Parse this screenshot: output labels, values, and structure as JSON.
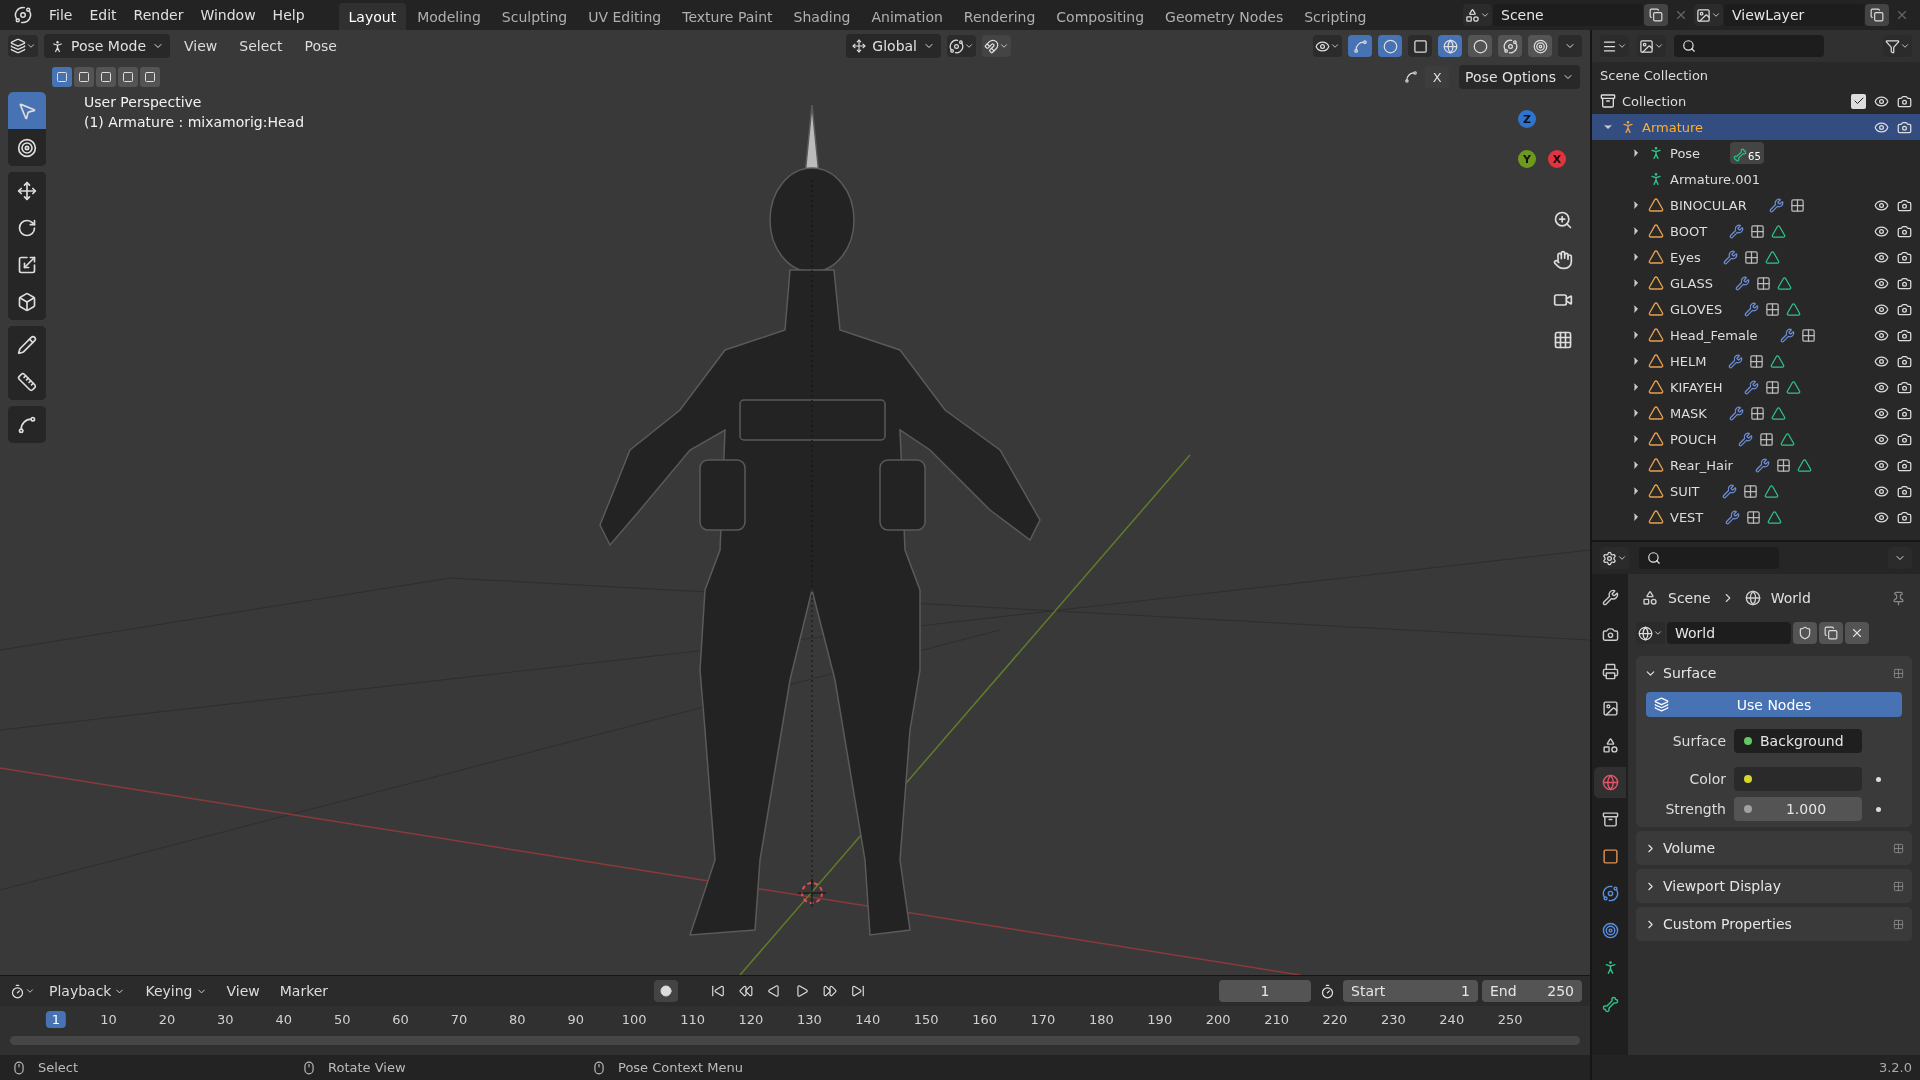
{
  "menu": [
    "File",
    "Edit",
    "Render",
    "Window",
    "Help"
  ],
  "workspaces": [
    {
      "label": "Layout",
      "selected": true
    },
    {
      "label": "Modeling",
      "selected": false
    },
    {
      "label": "Sculpting",
      "selected": false
    },
    {
      "label": "UV Editing",
      "selected": false
    },
    {
      "label": "Texture Paint",
      "selected": false
    },
    {
      "label": "Shading",
      "selected": false
    },
    {
      "label": "Animation",
      "selected": false
    },
    {
      "label": "Rendering",
      "selected": false
    },
    {
      "label": "Compositing",
      "selected": false
    },
    {
      "label": "Geometry Nodes",
      "selected": false
    },
    {
      "label": "Scripting",
      "selected": false
    }
  ],
  "scene": "Scene",
  "view_layer": "ViewLayer",
  "viewport": {
    "mode": "Pose Mode",
    "menus": [
      "View",
      "Select",
      "Pose"
    ],
    "orientation": "Global",
    "pose_options": "Pose Options",
    "mirror_x": "X",
    "select_modes": [
      {
        "selected": true
      },
      {
        "selected": false
      },
      {
        "selected": false
      },
      {
        "selected": false
      },
      {
        "selected": false
      }
    ],
    "shading": [
      {
        "kind": "wireframe",
        "selected": true
      },
      {
        "kind": "solid",
        "selected": false
      },
      {
        "kind": "material",
        "selected": false
      },
      {
        "kind": "rendered",
        "selected": false
      }
    ],
    "tools": [
      {
        "kind": "select",
        "selected": true
      },
      {
        "kind": "cursor",
        "selected": false
      },
      {
        "kind": "move",
        "selected": false
      },
      {
        "kind": "rotate",
        "selected": false
      },
      {
        "kind": "scale",
        "selected": false
      },
      {
        "kind": "transform",
        "selected": false
      },
      {
        "kind": "annotate",
        "selected": false
      },
      {
        "kind": "measure",
        "selected": false
      },
      {
        "kind": "relax",
        "selected": false
      }
    ],
    "overlay": [
      "User Perspective",
      "(1) Armature : mixamorig:Head"
    ],
    "gizmo": [
      {
        "label": "Z",
        "color": "#2f74d0"
      },
      {
        "label": "Y",
        "color": "#6e9a1c"
      },
      {
        "label": "X",
        "color": "#e2333f"
      }
    ]
  },
  "outliner": {
    "title": "Scene Collection",
    "collection": {
      "name": "Collection",
      "checked": true
    },
    "items": [
      {
        "name": "Armature",
        "kind": "armature",
        "selected": true,
        "expanded": true,
        "children": [
          {
            "name": "Pose",
            "kind": "pose",
            "expanded": false,
            "badge": "65"
          },
          {
            "name": "Armature.001",
            "kind": "armature_data"
          },
          {
            "name": "BINOCULAR",
            "kind": "mesh",
            "expanded": false,
            "has_mesh_data": false
          },
          {
            "name": "BOOT",
            "kind": "mesh",
            "expanded": false,
            "has_mesh_data": true
          },
          {
            "name": "Eyes",
            "kind": "mesh",
            "expanded": false,
            "has_mesh_data": true
          },
          {
            "name": "GLASS",
            "kind": "mesh",
            "expanded": false,
            "has_mesh_data": true
          },
          {
            "name": "GLOVES",
            "kind": "mesh",
            "expanded": false,
            "has_mesh_data": true
          },
          {
            "name": "Head_Female",
            "kind": "mesh",
            "expanded": false,
            "has_mesh_data": false
          },
          {
            "name": "HELM",
            "kind": "mesh",
            "expanded": false,
            "has_mesh_data": true
          },
          {
            "name": "KIFAYEH",
            "kind": "mesh",
            "expanded": false,
            "has_mesh_data": true
          },
          {
            "name": "MASK",
            "kind": "mesh",
            "expanded": false,
            "has_mesh_data": true
          },
          {
            "name": "POUCH",
            "kind": "mesh",
            "expanded": false,
            "has_mesh_data": true
          },
          {
            "name": "Rear_Hair",
            "kind": "mesh",
            "expanded": false,
            "has_mesh_data": true
          },
          {
            "name": "SUIT",
            "kind": "mesh",
            "expanded": false,
            "has_mesh_data": true
          },
          {
            "name": "VEST",
            "kind": "mesh",
            "expanded": false,
            "has_mesh_data": true
          }
        ]
      }
    ]
  },
  "properties": {
    "tabs": [
      {
        "kind": "tool",
        "selected": false
      },
      {
        "kind": "render",
        "selected": false
      },
      {
        "kind": "output",
        "selected": false
      },
      {
        "kind": "view_layer",
        "selected": false
      },
      {
        "kind": "scene",
        "selected": false
      },
      {
        "kind": "world",
        "selected": true
      },
      {
        "kind": "collection",
        "selected": false
      },
      {
        "kind": "object",
        "selected": false
      },
      {
        "kind": "physics",
        "selected": false
      },
      {
        "kind": "constraints",
        "selected": false
      },
      {
        "kind": "armature",
        "selected": false
      },
      {
        "kind": "bone",
        "selected": false
      }
    ],
    "breadcrumb": [
      "Scene",
      "World"
    ],
    "datablock": "World",
    "panels": [
      {
        "title": "Surface",
        "expanded": true,
        "button": "Use Nodes",
        "fields": [
          {
            "label": "Surface",
            "kind": "link",
            "value": "Background",
            "color": "#63c763"
          },
          {
            "label": "Color",
            "kind": "color",
            "color": "#d6d62e"
          },
          {
            "label": "Strength",
            "kind": "number",
            "value": "1.000",
            "color": "#a1a1a1"
          }
        ]
      },
      {
        "title": "Volume",
        "expanded": false
      },
      {
        "title": "Viewport Display",
        "expanded": false
      },
      {
        "title": "Custom Properties",
        "expanded": false
      }
    ]
  },
  "timeline": {
    "menus": [
      "Playback",
      "Keying",
      "View",
      "Marker"
    ],
    "current_frame": "1",
    "start_label": "Start",
    "start": "1",
    "end_label": "End",
    "end": "250",
    "ruler": [
      {
        "label": "1",
        "selected": true
      },
      {
        "label": "10",
        "selected": false
      },
      {
        "label": "20",
        "selected": false
      },
      {
        "label": "30",
        "selected": false
      },
      {
        "label": "40",
        "selected": false
      },
      {
        "label": "50",
        "selected": false
      },
      {
        "label": "60",
        "selected": false
      },
      {
        "label": "70",
        "selected": false
      },
      {
        "label": "80",
        "selected": false
      },
      {
        "label": "90",
        "selected": false
      },
      {
        "label": "100",
        "selected": false
      },
      {
        "label": "110",
        "selected": false
      },
      {
        "label": "120",
        "selected": false
      },
      {
        "label": "130",
        "selected": false
      },
      {
        "label": "140",
        "selected": false
      },
      {
        "label": "150",
        "selected": false
      },
      {
        "label": "160",
        "selected": false
      },
      {
        "label": "170",
        "selected": false
      },
      {
        "label": "180",
        "selected": false
      },
      {
        "label": "190",
        "selected": false
      },
      {
        "label": "200",
        "selected": false
      },
      {
        "label": "210",
        "selected": false
      },
      {
        "label": "220",
        "selected": false
      },
      {
        "label": "230",
        "selected": false
      },
      {
        "label": "240",
        "selected": false
      },
      {
        "label": "250",
        "selected": false
      }
    ]
  },
  "status_bar": {
    "hints": [
      "Select",
      "Rotate View",
      "Pose Context Menu"
    ],
    "version": "3.2.0"
  }
}
